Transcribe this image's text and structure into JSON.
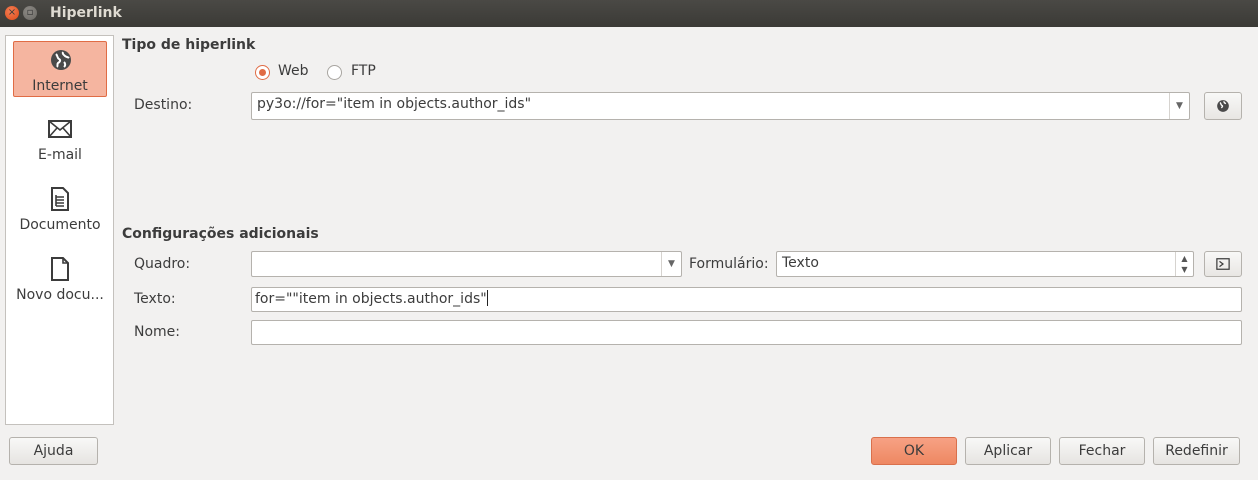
{
  "window": {
    "title": "Hiperlink",
    "close_glyph": "×",
    "max_glyph": "▫"
  },
  "sidebar": {
    "items": [
      {
        "label": "Internet",
        "icon": "globe-icon",
        "selected": true
      },
      {
        "label": "E-mail",
        "icon": "envelope-icon",
        "selected": false
      },
      {
        "label": "Documento",
        "icon": "document-icon",
        "selected": false
      },
      {
        "label": "Novo docu...",
        "icon": "new-document-icon",
        "selected": false
      }
    ]
  },
  "hyperlink_type": {
    "title": "Tipo de hiperlink",
    "web_label": "Web",
    "ftp_label": "FTP",
    "selected": "Web",
    "target_label": "Destino:",
    "target_value": "py3o://for=\"item in objects.author_ids\""
  },
  "additional": {
    "title": "Configurações adicionais",
    "frame_label": "Quadro:",
    "frame_value": "",
    "form_label": "Formulário:",
    "form_value": "Texto",
    "text_label": "Texto:",
    "text_value": "for=\"\"item in objects.author_ids\"",
    "name_label": "Nome:",
    "name_value": ""
  },
  "buttons": {
    "help": "Ajuda",
    "ok": "OK",
    "apply": "Aplicar",
    "close": "Fechar",
    "reset": "Redefinir"
  },
  "colors": {
    "accent": "#e06c45",
    "selected_bg": "#f5b5a0",
    "titlebar": "#3b3a36",
    "dialog_bg": "#f2f1f0"
  }
}
